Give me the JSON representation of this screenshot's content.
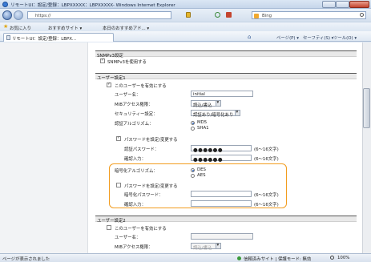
{
  "window": {
    "title": "リモートUI：設定/登録：LBPXXXXX：LBPXXXXX- Windows Internet Explorer"
  },
  "address": {
    "url": "https://"
  },
  "search": {
    "engine": "Bing"
  },
  "favorites": {
    "label": "お気に入り",
    "item1": "おすすめサイト ▾",
    "item2": "本日のおすすめアド... ▾"
  },
  "tab": {
    "label": "リモートUI：設定/登録：LBPX..."
  },
  "toolbar": {
    "page": "ページ(P) ▾",
    "safety": "セーフティ(S) ▾",
    "tools": "ツール(O) ▾"
  },
  "snmp": {
    "header": "SNMPv3設定",
    "use_label": "SNMPv3を使用する"
  },
  "user1": {
    "header": "ユーザー設定1",
    "enable_label": "このユーザーを有効にする",
    "username_label": "ユーザー名：",
    "username_value": "initial",
    "mib_label": "MIBアクセス権限：",
    "mib_value": "読込/書込",
    "security_label": "セキュリティー設定：",
    "security_value": "認証あり/暗号化あり",
    "auth_algo_label": "認証アルゴリズム：",
    "auth_options": [
      "MD5",
      "SHA1"
    ],
    "set_auth_pw_label": "パスワードを設定/変更する",
    "auth_pw_label": "認証パスワード：",
    "auth_pw_value": "●●●●●●",
    "confirm_label": "確認入力：",
    "confirm_value": "●●●●●●",
    "pw_hint": "(6〜16文字)",
    "enc_algo_label": "暗号化アルゴリズム：",
    "enc_options": [
      "DES",
      "AES"
    ],
    "set_enc_pw_label": "パスワードを設定/変更する",
    "enc_pw_label": "暗号化パスワード：",
    "enc_confirm_label": "確認入力："
  },
  "user2": {
    "header": "ユーザー設定2",
    "enable_label": "このユーザーを有効にする",
    "username_label": "ユーザー名：",
    "mib_label": "MIBアクセス権限：",
    "mib_value": "読込/書込"
  },
  "status": {
    "left": "ページが表示されました",
    "zone": "信頼済みサイト | 保護モード: 無効",
    "zoom": "100%"
  },
  "colors": {
    "highlight": "#f29c1e",
    "ie_blue": "#4d76b3"
  }
}
